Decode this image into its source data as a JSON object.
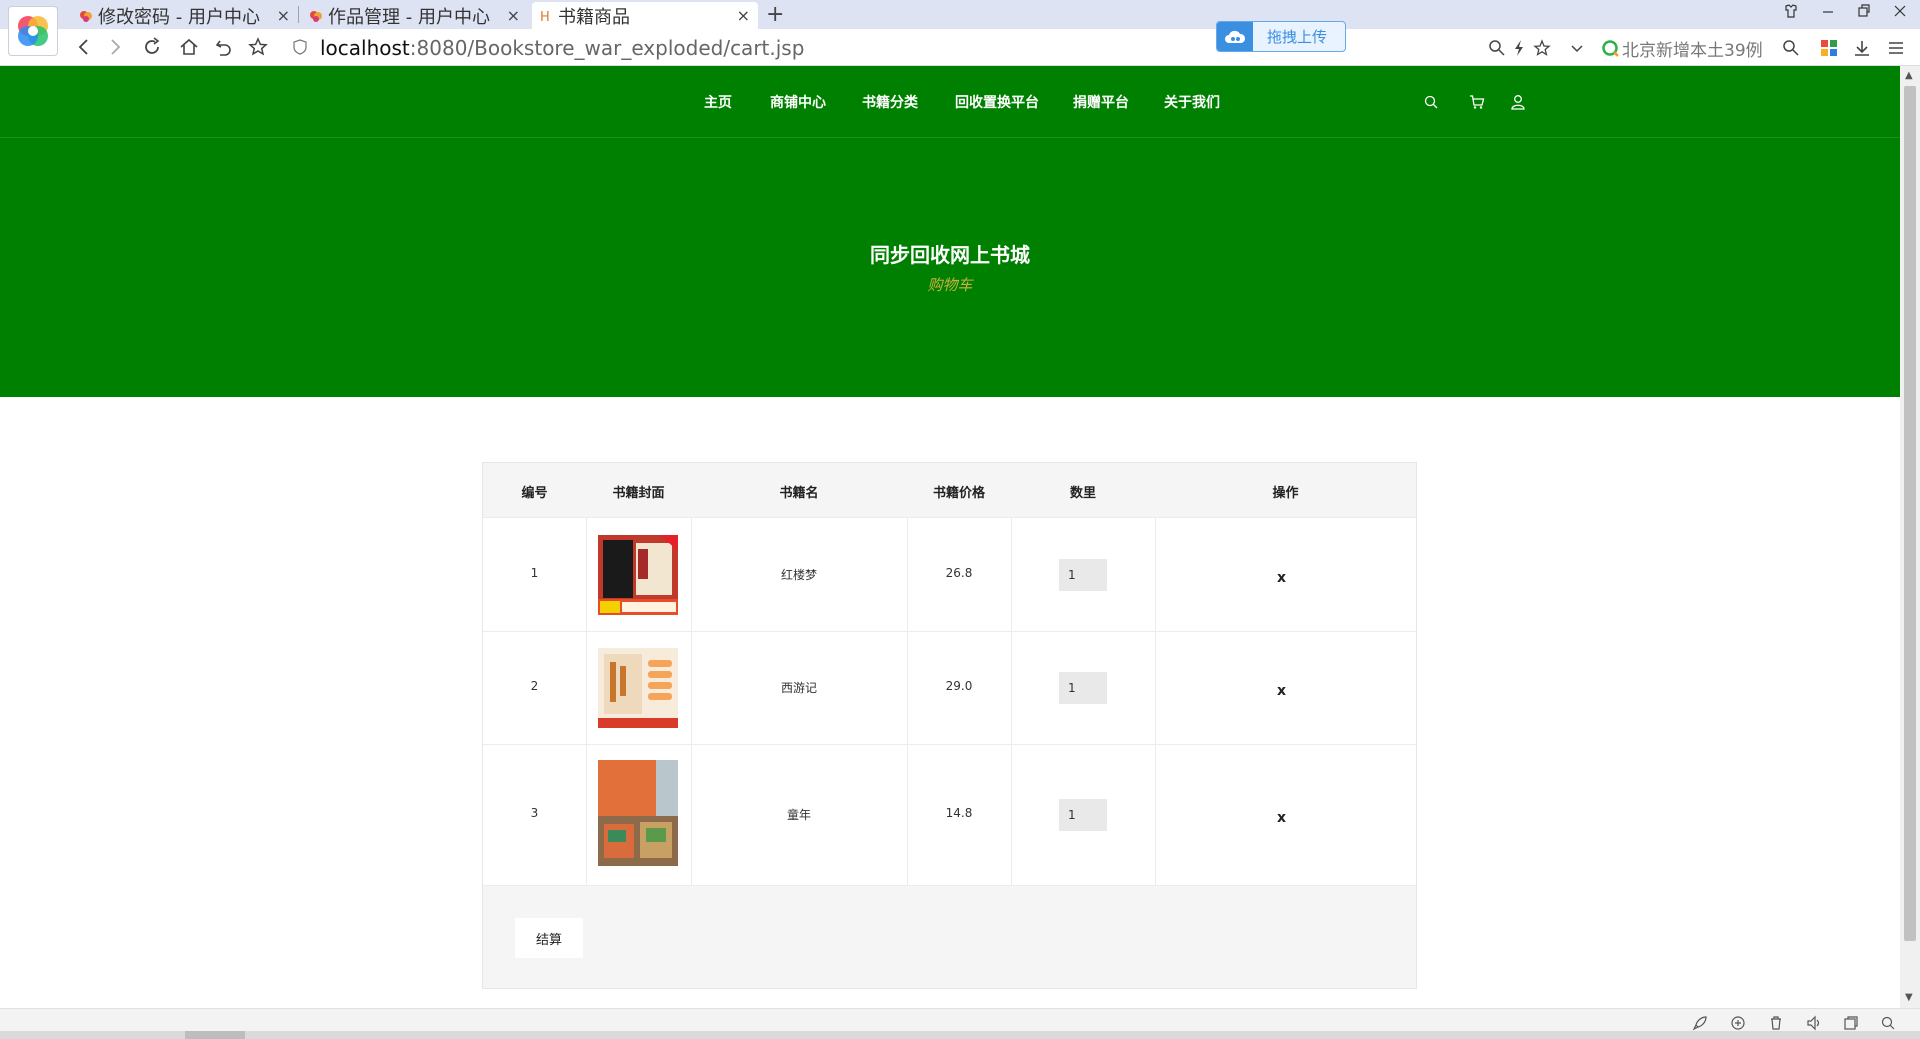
{
  "browser": {
    "tabs": [
      {
        "label": "修改密码 - 用户中心",
        "close": "×"
      },
      {
        "label": "作品管理 - 用户中心",
        "close": "×"
      },
      {
        "label": "书籍商品",
        "close": "×"
      }
    ],
    "new_tab": "+",
    "url_host": "localhost",
    "url_rest": ":8080/Bookstore_war_exploded/cart.jsp",
    "upload_label": "拖拽上传",
    "search_hint": "北京新增本土39例"
  },
  "site": {
    "nav": [
      "主页",
      "商铺中心",
      "书籍分类",
      "回收置换平台",
      "捐赠平台",
      "关于我们"
    ],
    "hero_title": "同步回收网上书城",
    "hero_subtitle": "购物车"
  },
  "cart": {
    "columns": [
      "编号",
      "书籍封面",
      "书籍名",
      "书籍价格",
      "数里",
      "操作"
    ],
    "rows": [
      {
        "id": "1",
        "name": "红楼梦",
        "price": "26.8",
        "qty": "1",
        "remove": "x"
      },
      {
        "id": "2",
        "name": "西游记",
        "price": "29.0",
        "qty": "1",
        "remove": "x"
      },
      {
        "id": "3",
        "name": "童年",
        "price": "14.8",
        "qty": "1",
        "remove": "x"
      }
    ],
    "checkout_label": "结算"
  },
  "colors": {
    "header_green": "#008000",
    "subtitle_gold": "#c8b045",
    "table_head_bg": "#f5f5f5",
    "browser_tabbar": "#dde3f2"
  },
  "icons": [
    "browser-logo-icon",
    "search-icon",
    "cart-icon",
    "user-icon",
    "back-icon",
    "forward-icon",
    "reload-icon",
    "home-icon",
    "undo-icon",
    "star-icon",
    "shield-icon",
    "cloud-icon"
  ]
}
